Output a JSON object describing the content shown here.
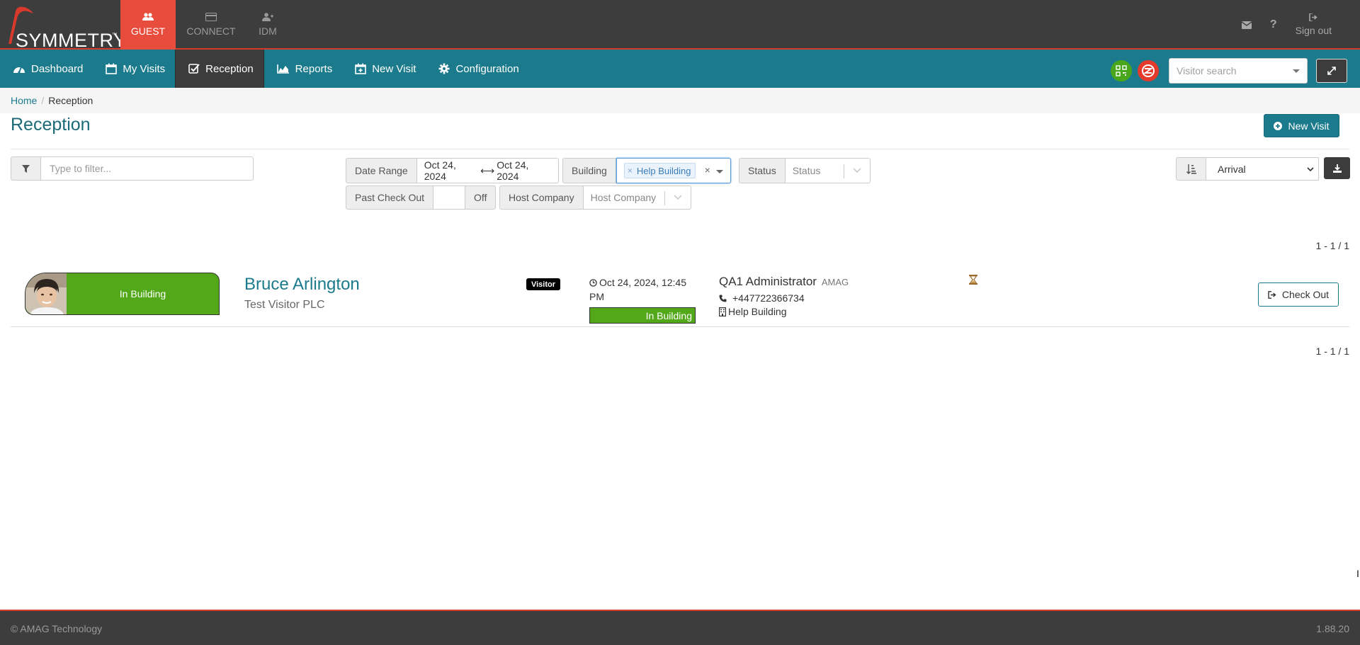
{
  "app": {
    "logo_text": "SYMMETRY",
    "logo_tm": "™",
    "top_tabs": [
      {
        "label": "GUEST",
        "icon": "users-icon",
        "active": true
      },
      {
        "label": "CONNECT",
        "icon": "card-icon",
        "active": false
      },
      {
        "label": "IDM",
        "icon": "user-plus-icon",
        "active": false
      }
    ],
    "sign_out": "Sign out"
  },
  "nav": {
    "items": [
      {
        "label": "Dashboard",
        "icon": "dashboard-icon"
      },
      {
        "label": "My Visits",
        "icon": "calendar-icon"
      },
      {
        "label": "Reception",
        "icon": "check-square-icon",
        "active": true
      },
      {
        "label": "Reports",
        "icon": "area-chart-icon"
      },
      {
        "label": "New Visit",
        "icon": "calendar-plus-icon"
      },
      {
        "label": "Configuration",
        "icon": "gear-icon"
      }
    ],
    "visitor_search_placeholder": "Visitor search"
  },
  "breadcrumb": {
    "home": "Home",
    "current": "Reception"
  },
  "page": {
    "title": "Reception",
    "new_visit_label": "New Visit"
  },
  "filters": {
    "filter_placeholder": "Type to filter...",
    "date_range_label": "Date Range",
    "date_from": "Oct 24, 2024",
    "date_to": "Oct 24, 2024",
    "building_label": "Building",
    "building_tag": "Help Building",
    "status_label": "Status",
    "status_placeholder": "Status",
    "past_checkout_label": "Past Check Out",
    "past_checkout_value": "Off",
    "host_company_label": "Host Company",
    "host_company_placeholder": "Host Company",
    "sort_value": "Arrival"
  },
  "pager": {
    "text": "1 - 1 / 1"
  },
  "visits": [
    {
      "status": "In Building",
      "name": "Bruce Arlington",
      "company": "Test Visitor PLC",
      "type_badge": "Visitor",
      "arrival": "Oct 24, 2024, 12:45 PM",
      "arrival_line1": "Oct 24, 2024, 12:45",
      "arrival_line2": "PM",
      "bar_status": "In Building",
      "host_name": "QA1 Administrator",
      "host_company": "AMAG",
      "host_phone": "+447722366734",
      "host_building": "Help Building",
      "action": "Check Out"
    }
  ],
  "footer": {
    "copyright": "© AMAG Technology",
    "version": "1.88.20"
  },
  "colors": {
    "brand_teal": "#1b7b8c",
    "accent_red": "#e84c3d",
    "status_green": "#52a818",
    "topbar": "#3d3d3d"
  }
}
